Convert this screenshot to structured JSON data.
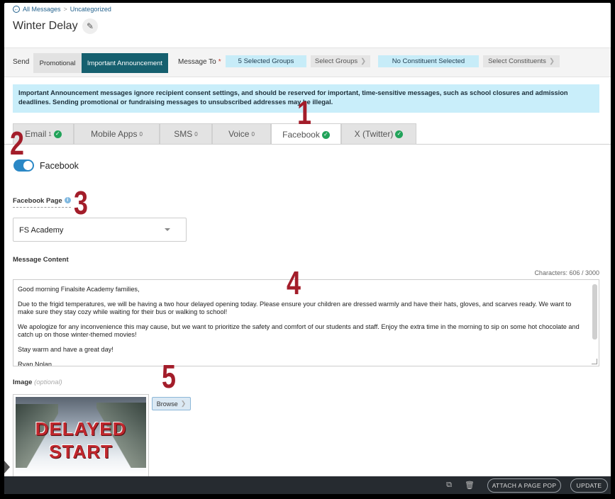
{
  "breadcrumb": {
    "back_label": "All Messages",
    "separator": ">",
    "current": "Uncategorized"
  },
  "page_title": "Winter Delay",
  "send_bar": {
    "send_label": "Send",
    "promotional_label": "Promotional",
    "important_label": "Important Announcement",
    "message_to_label": "Message To",
    "required_mark": "*",
    "selected_groups": "5 Selected Groups",
    "select_groups_label": "Select Groups",
    "constituent_status": "No Constituent Selected",
    "select_constituents_label": "Select Constituents"
  },
  "banner_text": "Important Announcement messages ignore recipient consent settings, and should be reserved for important, time-sensitive messages, such as school closures and admission deadlines. Sending promotional or fundraising messages to unsubscribed addresses may be illegal.",
  "tabs": [
    {
      "label": "Email",
      "count": "1",
      "checked": true
    },
    {
      "label": "Mobile Apps",
      "count": "0",
      "checked": false
    },
    {
      "label": "SMS",
      "count": "0",
      "checked": false
    },
    {
      "label": "Voice",
      "count": "0",
      "checked": false
    },
    {
      "label": "Facebook",
      "count": "",
      "checked": true,
      "active": true
    },
    {
      "label": "X (Twitter)",
      "count": "",
      "checked": true
    }
  ],
  "facebook_toggle": {
    "label": "Facebook",
    "on": true
  },
  "facebook_page": {
    "label": "Facebook Page",
    "selected": "FS Academy"
  },
  "message_content": {
    "label": "Message Content",
    "characters": "Characters: 606 / 3000",
    "paragraphs": [
      "Good morning Finalsite Academy families,",
      "Due to the frigid temperatures, we will be having a two hour delayed opening today. Please ensure your children are dressed warmly and have their hats, gloves, and scarves ready. We want to make sure they stay cozy while waiting for their bus or walking to school!",
      "We apologize for any inconvenience this may cause, but we want to prioritize the safety and comfort of our students and staff. Enjoy the extra time in the morning to sip on some hot chocolate and catch up on those winter-themed movies!",
      "Stay warm and have a great day!",
      "Ryan Nolan"
    ]
  },
  "image": {
    "label": "Image",
    "optional": "(optional)",
    "thumb_line1": "DELAYED",
    "thumb_line2": "START",
    "browse_label": "Browse"
  },
  "footer": {
    "attach_label": "ATTACH A PAGE POP",
    "update_label": "UPDATE"
  },
  "callouts": [
    "1",
    "2",
    "3",
    "4",
    "5"
  ],
  "colors": {
    "accent": "#16606f",
    "callout": "#a31d2a",
    "toggle": "#2b88c6",
    "check": "#22a35a"
  }
}
